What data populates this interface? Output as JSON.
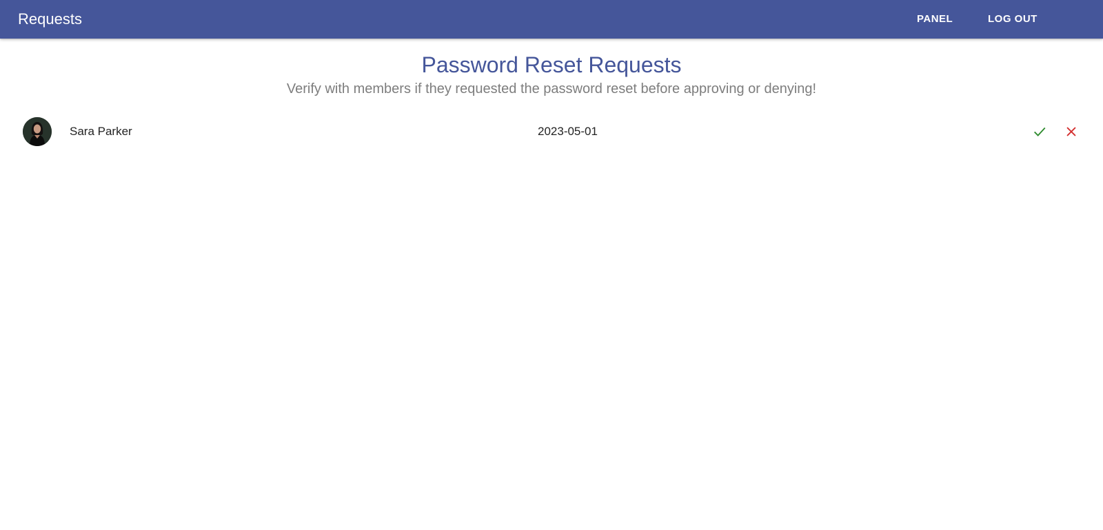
{
  "appbar": {
    "title": "Requests",
    "nav": {
      "panel_label": "PANEL",
      "logout_label": "LOG OUT"
    }
  },
  "main": {
    "heading": "Password Reset Requests",
    "subtitle": "Verify with members if they requested the password reset before approving or denying!",
    "requests": [
      {
        "name": "Sara Parker",
        "date": "2023-05-01",
        "avatar_icon": "avatar-photo",
        "approve_icon": "check-icon",
        "deny_icon": "close-icon"
      }
    ]
  },
  "colors": {
    "primary": "#45569a",
    "approve": "#2e8b2e",
    "deny": "#d32f2f",
    "subtitle": "#7d7d7d"
  }
}
